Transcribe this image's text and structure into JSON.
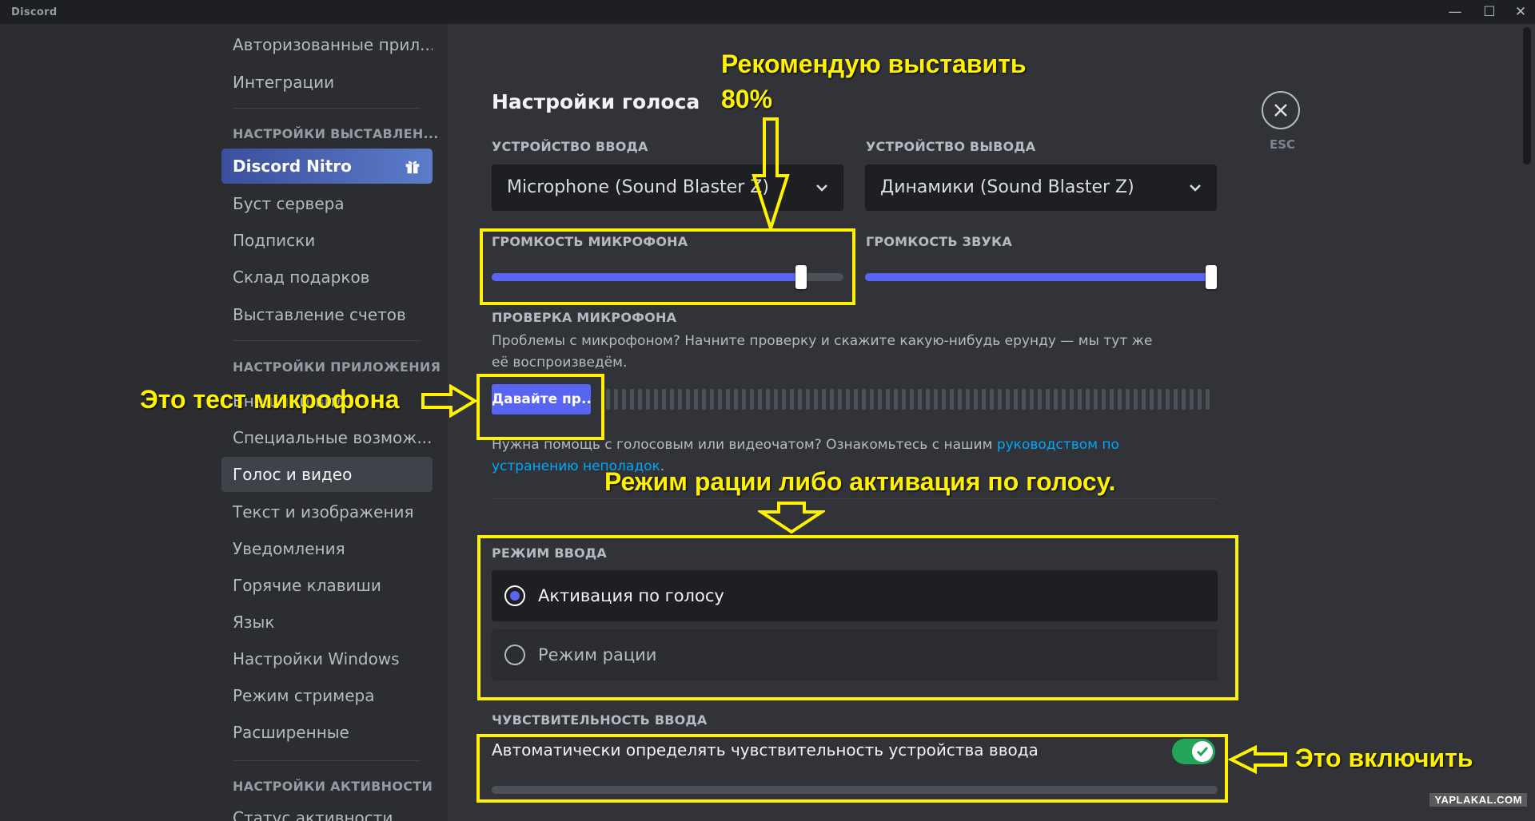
{
  "window": {
    "title": "Discord",
    "controls": [
      "—",
      "☐",
      "✕"
    ]
  },
  "sidebar": {
    "items_top": [
      "Авторизованные прил...",
      "Интеграции"
    ],
    "billing_header": "НАСТРОЙКИ ВЫСТАВЛЕН...",
    "nitro_label": "Discord Nitro",
    "billing_items": [
      "Буст сервера",
      "Подписки",
      "Склад подарков",
      "Выставление счетов"
    ],
    "app_header": "НАСТРОЙКИ ПРИЛОЖЕНИЯ",
    "app_items": [
      "Внешний вид",
      "Специальные возмож...",
      "Голос и видео",
      "Текст и изображения",
      "Уведомления",
      "Горячие клавиши",
      "Язык",
      "Настройки Windows",
      "Режим стримера",
      "Расширенные"
    ],
    "selected_item": "Голос и видео",
    "activity_header": "НАСТРОЙКИ АКТИВНОСТИ",
    "activity_items": [
      "Статус активности"
    ]
  },
  "voice": {
    "title": "Настройки голоса",
    "input_device_label": "УСТРОЙСТВО ВВОДА",
    "input_device_value": "Microphone (Sound Blaster Z)",
    "output_device_label": "УСТРОЙСТВО ВЫВОДА",
    "output_device_value": "Динамики (Sound Blaster Z)",
    "mic_volume_label": "ГРОМКОСТЬ МИКРОФОНА",
    "mic_volume_percent": 88,
    "sound_volume_label": "ГРОМКОСТЬ ЗВУКА",
    "sound_volume_percent": 100,
    "mic_test_label": "ПРОВЕРКА МИКРОФОНА",
    "mic_test_desc": "Проблемы с микрофоном? Начните проверку и скажите какую-нибудь ерунду — мы тут же её воспроизведём.",
    "mic_test_button": "Давайте пр...",
    "help_text": "Нужна помощь с голосовым или видеочатом? Ознакомьтесь с нашим ",
    "help_link": "руководством по устранению неполадок",
    "help_end": ".",
    "input_mode_label": "РЕЖИМ ВВОДА",
    "mode_voice": "Активация по голосу",
    "mode_ptt": "Режим рации",
    "sensitivity_label": "ЧУВСТВИТЕЛЬНОСТЬ ВВОДА",
    "auto_sensitivity": "Автоматически определять чувствительность устройства ввода",
    "auto_sensitivity_on": true
  },
  "close": {
    "label": "ESC"
  },
  "annotations": {
    "recommend_line1": "Рекомендую выставить",
    "recommend_line2": "80%",
    "mic_test": "Это тест микрофона",
    "mode_hint": "Режим рации либо активация по голосу.",
    "enable_hint": "Это включить"
  },
  "watermark": "YAPLAKAL.COM",
  "colors": {
    "accent": "#5865f2",
    "annotation": "#fff200",
    "toggle_on": "#23a55a",
    "link": "#00a8fc"
  }
}
